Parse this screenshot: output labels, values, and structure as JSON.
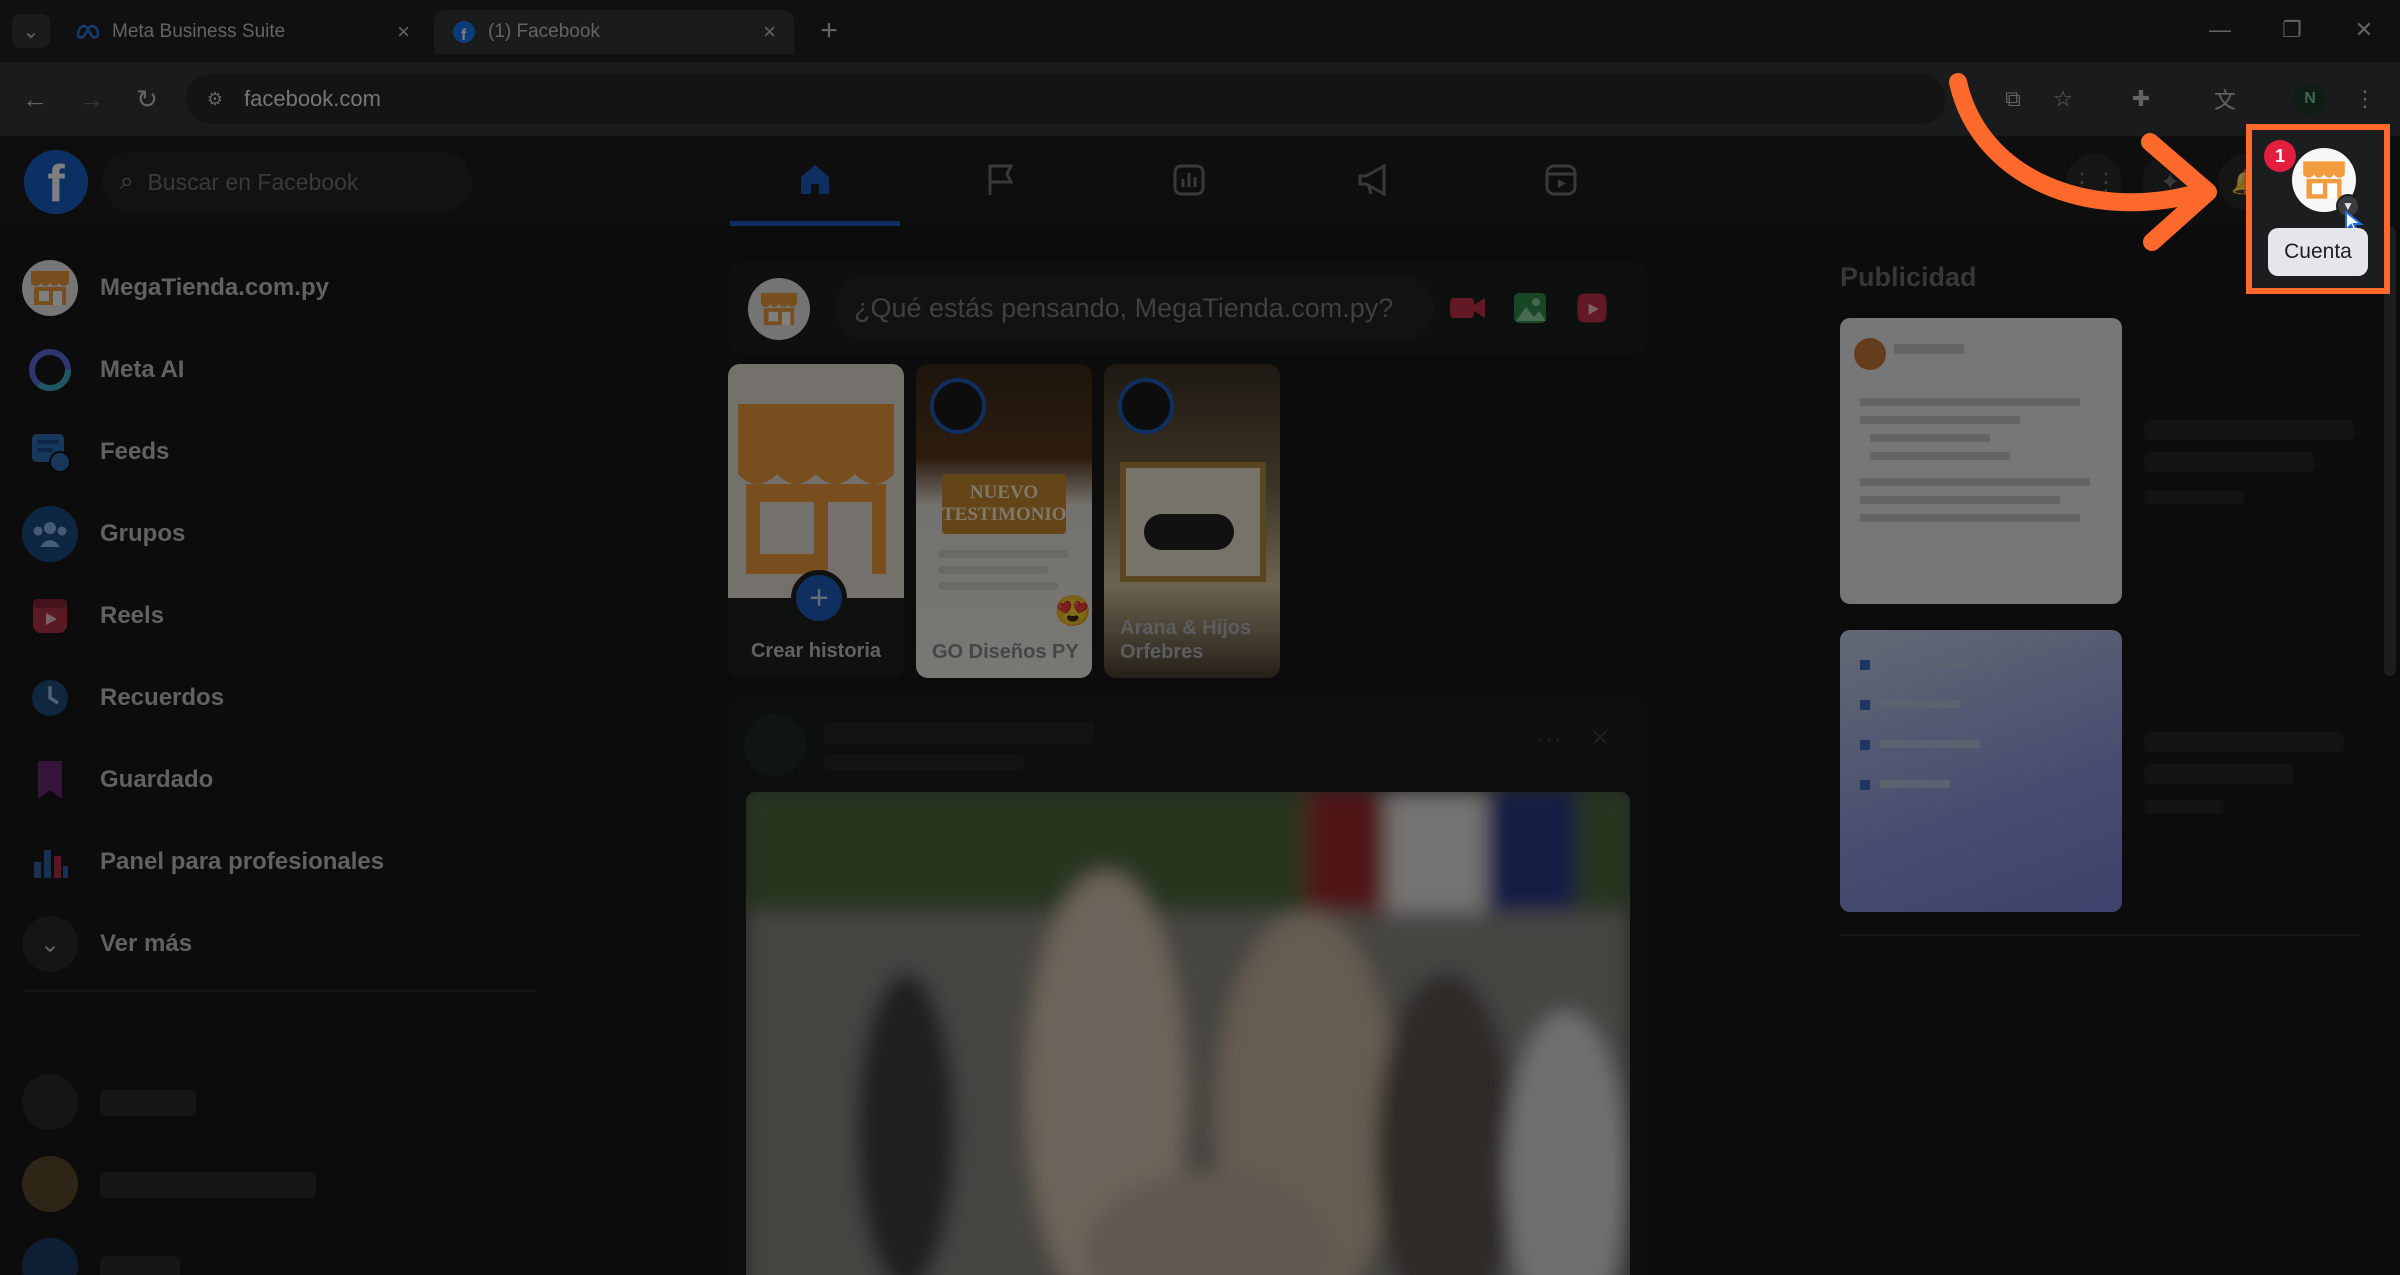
{
  "browser": {
    "tabs": [
      {
        "title": "Meta Business Suite",
        "active": false
      },
      {
        "title": "(1) Facebook",
        "active": true
      }
    ],
    "url": "facebook.com",
    "profile_initial": "N"
  },
  "facebook": {
    "search_placeholder": "Buscar en Facebook",
    "nav": [
      {
        "icon": "home-icon",
        "active": true
      },
      {
        "icon": "flag-icon",
        "active": false
      },
      {
        "icon": "chart-icon",
        "active": false
      },
      {
        "icon": "megaphone-icon",
        "active": false
      },
      {
        "icon": "reels-icon",
        "active": false
      }
    ],
    "notification_count": "1",
    "account_tooltip": "Cuenta"
  },
  "sidebar": {
    "items": [
      {
        "label": "MegaTienda.com.py",
        "icon": "store-icon"
      },
      {
        "label": "Meta AI",
        "icon": "meta-ai-icon"
      },
      {
        "label": "Feeds",
        "icon": "feeds-icon"
      },
      {
        "label": "Grupos",
        "icon": "groups-icon"
      },
      {
        "label": "Reels",
        "icon": "reels-icon"
      },
      {
        "label": "Recuerdos",
        "icon": "memories-icon"
      },
      {
        "label": "Guardado",
        "icon": "bookmark-icon"
      },
      {
        "label": "Panel para profesionales",
        "icon": "dashboard-icon"
      },
      {
        "label": "Ver más",
        "icon": "chevron-down-icon"
      }
    ]
  },
  "feed": {
    "composer_placeholder": "¿Qué estás pensando, MegaTienda.com.py?",
    "stories": [
      {
        "label": "Crear historia"
      },
      {
        "label": "GO Diseños PY",
        "overlay_text": "NUEVO TESTIMONIO"
      },
      {
        "label": "Arana & Hijos Orfebres"
      }
    ]
  },
  "right": {
    "ads_title": "Publicidad"
  },
  "colors": {
    "accent": "#1c5fbf",
    "highlight": "#ff6a2c",
    "badge": "#e41e3f"
  }
}
